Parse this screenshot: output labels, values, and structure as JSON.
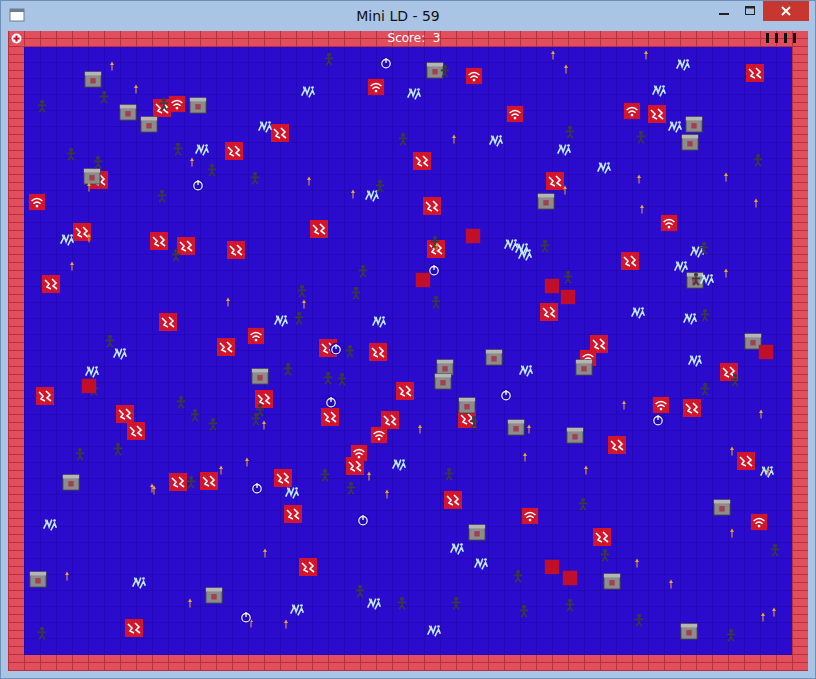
{
  "window": {
    "title": "Mini LD - 59"
  },
  "hud": {
    "score": "Score:  3",
    "ammo": 4
  },
  "sprites": [
    {
      "kind": "red-tile",
      "count": 44,
      "color": "#d3152c"
    },
    {
      "kind": "wifi-tile",
      "count": 14,
      "color": "#d3152c"
    },
    {
      "kind": "crate",
      "count": 26,
      "color": "#8c8c8c"
    },
    {
      "kind": "virus",
      "count": 36,
      "color": "#bfe8ff"
    },
    {
      "kind": "zombie",
      "count": 60,
      "color": "#3b3b3b"
    },
    {
      "kind": "flame",
      "count": 46,
      "color": "#e8a632"
    },
    {
      "kind": "power-orb",
      "count": 10,
      "color": "#e8ecff"
    },
    {
      "kind": "block",
      "count": 8,
      "color": "#c10f2a"
    }
  ]
}
